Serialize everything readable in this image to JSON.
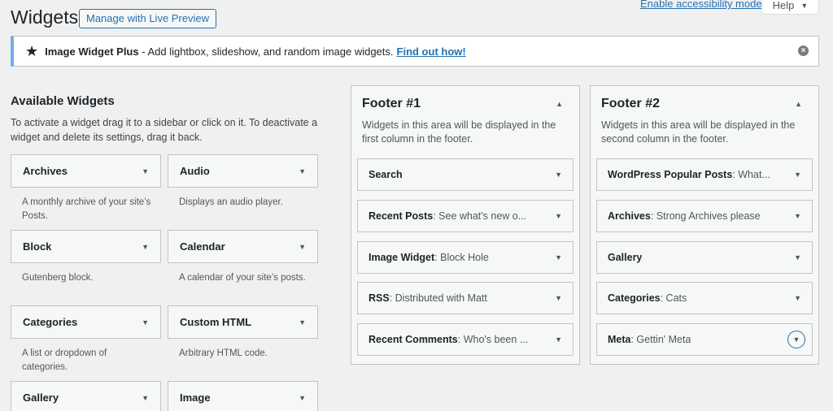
{
  "header": {
    "title": "Widgets",
    "live_preview_label": "Manage with Live Preview",
    "accessibility_link": "Enable accessibility mode",
    "help_label": "Help",
    "help_caret": "▼"
  },
  "notice": {
    "star": "★",
    "plugin_name": "Image Widget Plus",
    "text": " - Add lightbox, slideshow, and random image widgets.",
    "link_text": "Find out how!",
    "dismiss": "×"
  },
  "available": {
    "title": "Available Widgets",
    "description": "To activate a widget drag it to a sidebar or click on it. To deactivate a widget and delete its settings, drag it back.",
    "widgets": [
      {
        "name": "Archives",
        "desc": "A monthly archive of your site’s Posts."
      },
      {
        "name": "Audio",
        "desc": "Displays an audio player."
      },
      {
        "name": "Block",
        "desc": "Gutenberg block."
      },
      {
        "name": "Calendar",
        "desc": "A calendar of your site’s posts."
      },
      {
        "name": "Categories",
        "desc": "A list or dropdown of categories."
      },
      {
        "name": "Custom HTML",
        "desc": "Arbitrary HTML code."
      },
      {
        "name": "Gallery",
        "desc": ""
      },
      {
        "name": "Image",
        "desc": ""
      }
    ]
  },
  "arrows": {
    "down": "▼",
    "up": "▲"
  },
  "footer1": {
    "title": "Footer #1",
    "description": "Widgets in this area will be displayed in the first column in the footer.",
    "widgets": [
      {
        "name": "Search",
        "title": ""
      },
      {
        "name": "Recent Posts",
        "title": ": See what's new o..."
      },
      {
        "name": "Image Widget",
        "title": ": Block Hole"
      },
      {
        "name": "RSS",
        "title": ": Distributed with Matt"
      },
      {
        "name": "Recent Comments",
        "title": ": Who's been ..."
      }
    ]
  },
  "footer2": {
    "title": "Footer #2",
    "description": "Widgets in this area will be displayed in the second column in the footer.",
    "widgets": [
      {
        "name": "WordPress Popular Posts",
        "title": ": What..."
      },
      {
        "name": "Archives",
        "title": ": Strong Archives please"
      },
      {
        "name": "Gallery",
        "title": ""
      },
      {
        "name": "Categories",
        "title": ": Cats"
      },
      {
        "name": "Meta",
        "title": ": Gettin' Meta"
      }
    ]
  }
}
